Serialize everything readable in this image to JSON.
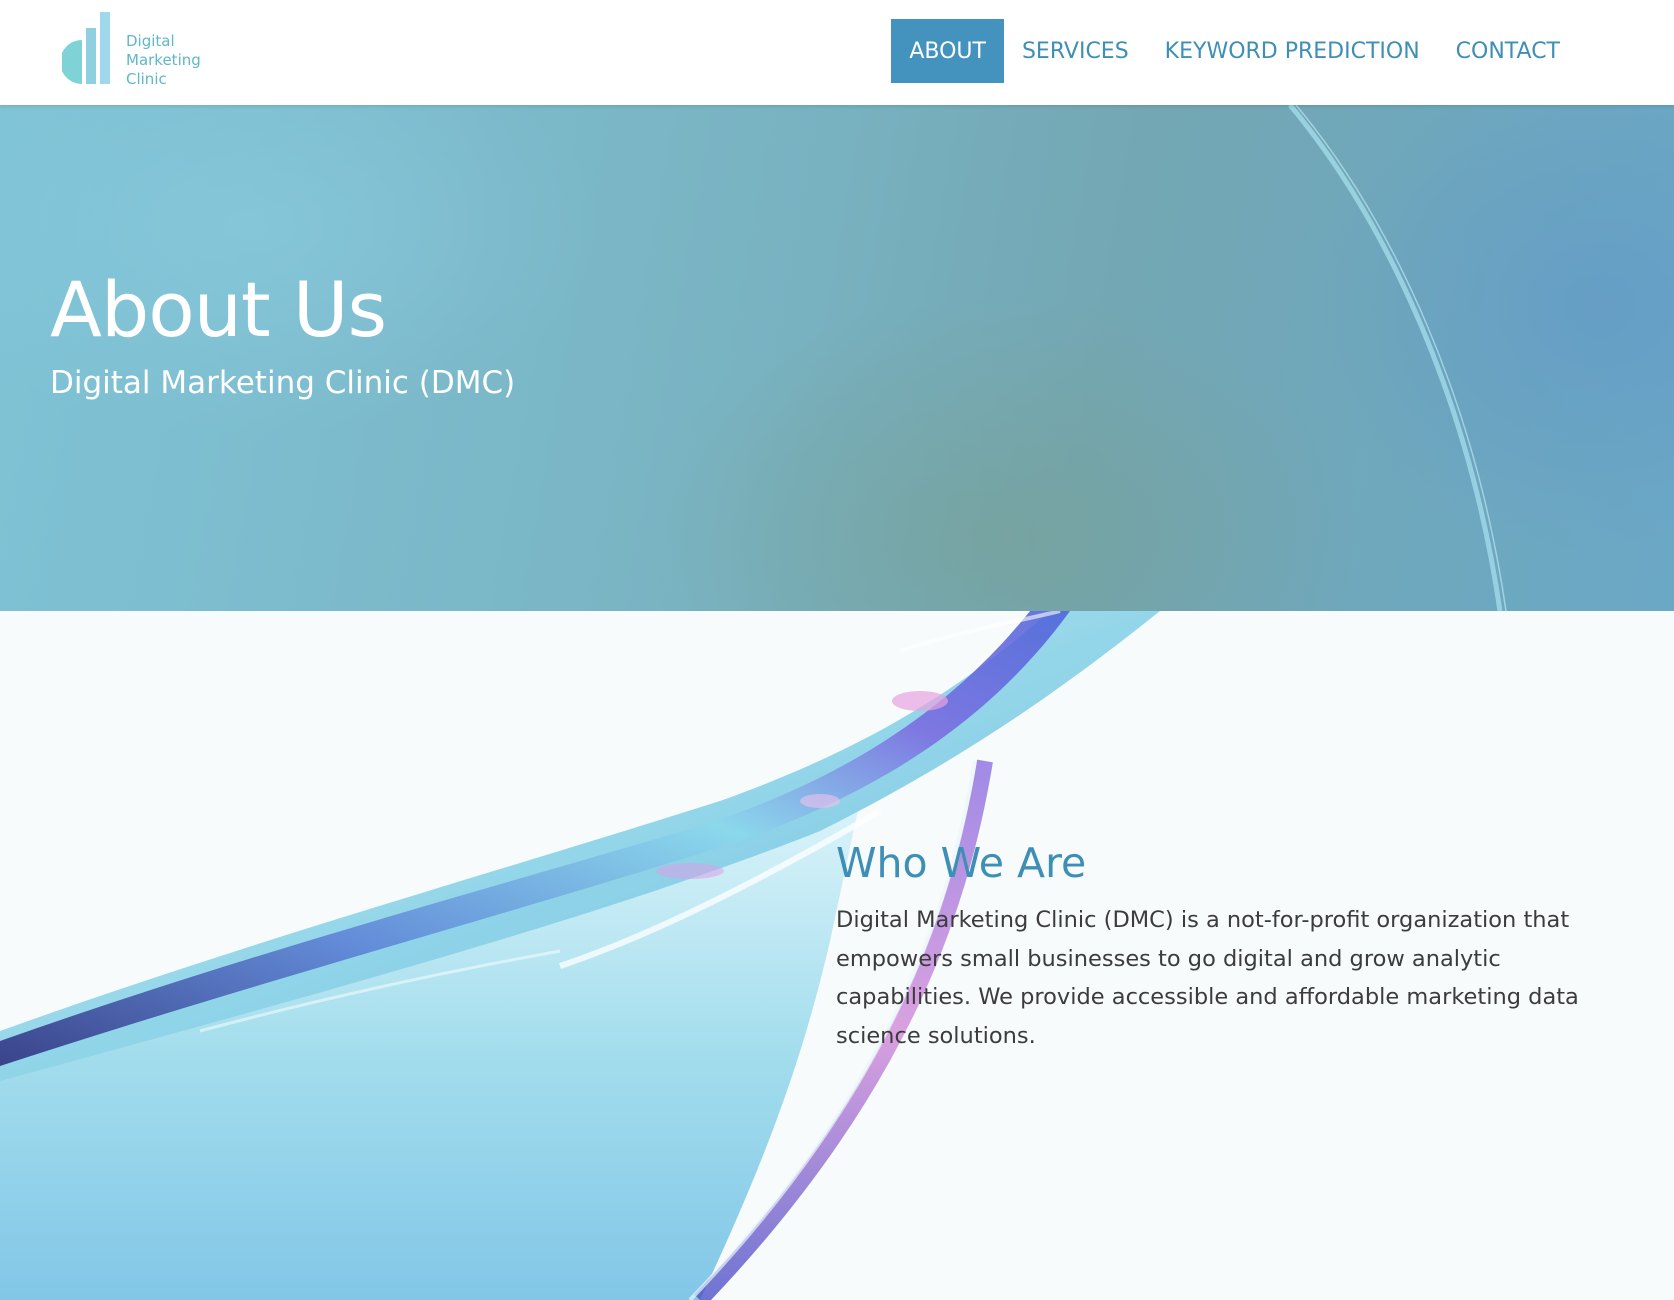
{
  "brand": {
    "logo_text": "Digital\nMarketing\nClinic",
    "logo_color": "#5fb8c8"
  },
  "nav": {
    "items": [
      {
        "label": "ABOUT",
        "active": true
      },
      {
        "label": "SERVICES",
        "active": false
      },
      {
        "label": "KEYWORD PREDICTION",
        "active": false
      },
      {
        "label": "CONTACT",
        "active": false
      }
    ],
    "active_bg": "#4393be",
    "link_color": "#3e8fb5"
  },
  "hero": {
    "title": "About Us",
    "subtitle": "Digital Marketing Clinic (DMC)"
  },
  "about": {
    "heading": "Who We Are",
    "body": "Digital Marketing Clinic (DMC) is a not-for-profit organization that empowers small businesses to go digital and grow analytic capabilities. We provide accessible and affordable marketing data science solutions."
  }
}
